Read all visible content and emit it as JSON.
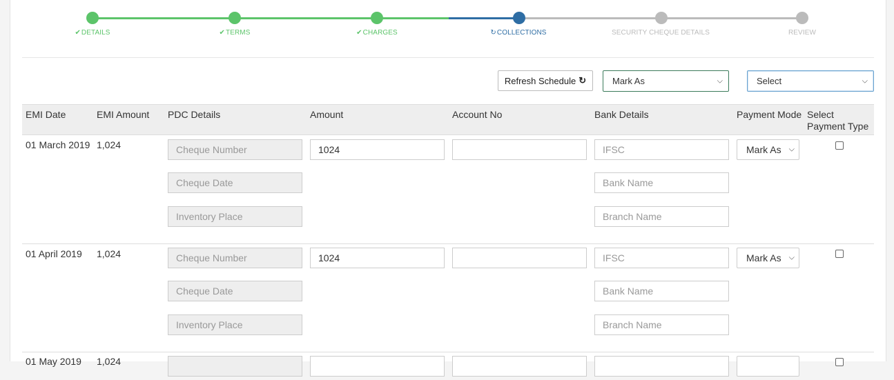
{
  "stepper": {
    "steps": [
      {
        "label": "DETAILS",
        "state": "done",
        "icon": "check-icon"
      },
      {
        "label": "TERMS",
        "state": "done",
        "icon": "check-icon"
      },
      {
        "label": "CHARGES",
        "state": "done",
        "icon": "check-icon"
      },
      {
        "label": "COLLECTIONS",
        "state": "active",
        "icon": "refresh-icon"
      },
      {
        "label": "SECURITY CHEQUE DETAILS",
        "state": "pending"
      },
      {
        "label": "REVIEW",
        "state": "pending"
      }
    ],
    "colors": {
      "done": "#5cc46a",
      "active": "#2e6da4",
      "pending": "#bbbbbb"
    }
  },
  "toolbar": {
    "refresh_label": "Refresh Schedule",
    "mark_as_value": "Mark As",
    "select_value": "Select"
  },
  "table": {
    "headers": {
      "emi_date": "EMI Date",
      "emi_amount": "EMI Amount",
      "pdc_details": "PDC Details",
      "amount": "Amount",
      "account_no": "Account No",
      "bank_details": "Bank Details",
      "payment_mode": "Payment Mode",
      "select_payment_type": "Select Payment Type"
    },
    "placeholders": {
      "cheque_number": "Cheque Number",
      "cheque_date": "Cheque Date",
      "inventory_place": "Inventory Place",
      "ifsc": "IFSC",
      "bank_name": "Bank Name",
      "branch_name": "Branch Name"
    },
    "rows": [
      {
        "emi_date": "01 March 2019",
        "emi_amount": "1,024",
        "amount": "1024",
        "account_no": "",
        "payment_mode": "Mark As"
      },
      {
        "emi_date": "01 April 2019",
        "emi_amount": "1,024",
        "amount": "1024",
        "account_no": "",
        "payment_mode": "Mark As"
      },
      {
        "emi_date": "01 May 2019",
        "emi_amount": "1,024",
        "amount": "",
        "account_no": "",
        "payment_mode": ""
      }
    ]
  }
}
